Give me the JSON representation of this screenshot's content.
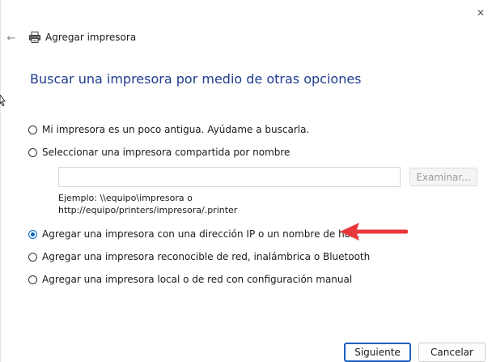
{
  "window": {
    "title": "Agregar impresora",
    "close_glyph": "✕",
    "back_glyph": "←"
  },
  "heading": "Buscar una impresora por medio de otras opciones",
  "options": [
    {
      "label": "Mi impresora es un poco antigua. Ayúdame a buscarla.",
      "checked": false
    },
    {
      "label": "Seleccionar una impresora compartida por nombre",
      "checked": false
    },
    {
      "label": "Agregar una impresora con una dirección IP o un nombre de host",
      "checked": true
    },
    {
      "label": "Agregar una impresora reconocible de red, inalámbrica o Bluetooth",
      "checked": false
    },
    {
      "label": "Agregar una impresora local o de red con configuración manual",
      "checked": false
    }
  ],
  "shared_printer": {
    "input_value": "",
    "browse_label": "Examinar...",
    "example_line1": "Ejemplo: \\\\equipo\\impresora o",
    "example_line2": "http://equipo/printers/impresora/.printer"
  },
  "footer": {
    "next_label": "Siguiente",
    "cancel_label": "Cancelar"
  },
  "colors": {
    "heading": "#1e3d8f",
    "accent": "#0067c0",
    "arrow": "#e8383b"
  },
  "icons": {
    "title": "printer-icon",
    "back": "back-arrow-icon",
    "close": "close-icon",
    "annotation": "red-arrow-icon"
  }
}
